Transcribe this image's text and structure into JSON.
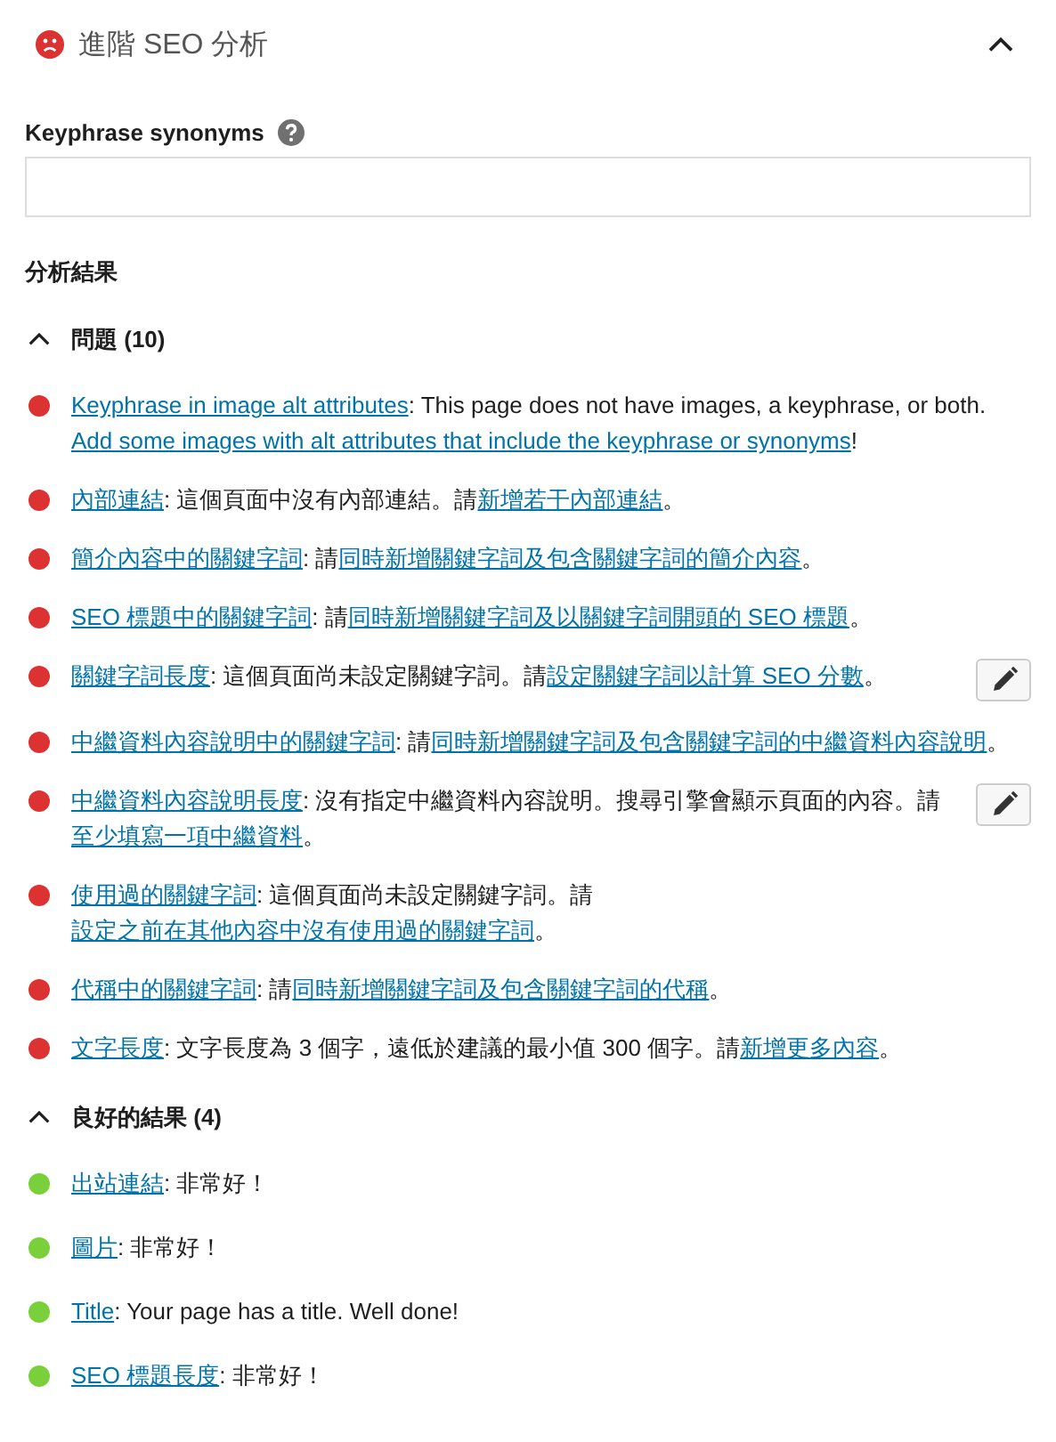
{
  "panel": {
    "title": "進階 SEO 分析",
    "expanded": true
  },
  "synonyms": {
    "label": "Keyphrase synonyms"
  },
  "results_heading": "分析結果",
  "groups": [
    {
      "title": "問題 (10)",
      "expanded": true,
      "items": [
        {
          "color": "#dc3232",
          "editable": false,
          "parts": [
            {
              "kind": "link",
              "text": "Keyphrase in image alt attributes"
            },
            {
              "kind": "text",
              "text": ": This page does not have images, a keyphrase, or both. "
            },
            {
              "kind": "link",
              "text": "Add some images with alt attributes that include the keyphrase or synonyms"
            },
            {
              "kind": "text",
              "text": "!"
            }
          ]
        },
        {
          "color": "#dc3232",
          "editable": false,
          "parts": [
            {
              "kind": "link",
              "text": "內部連結"
            },
            {
              "kind": "text",
              "text": ": 這個頁面中沒有內部連結。請"
            },
            {
              "kind": "link",
              "text": "新增若干內部連結"
            },
            {
              "kind": "text",
              "text": "。"
            }
          ]
        },
        {
          "color": "#dc3232",
          "editable": false,
          "parts": [
            {
              "kind": "link",
              "text": "簡介內容中的關鍵字詞"
            },
            {
              "kind": "text",
              "text": ": 請"
            },
            {
              "kind": "link",
              "text": "同時新增關鍵字詞及包含關鍵字詞的簡介內容"
            },
            {
              "kind": "text",
              "text": "。"
            }
          ]
        },
        {
          "color": "#dc3232",
          "editable": false,
          "parts": [
            {
              "kind": "link",
              "text": "SEO 標題中的關鍵字詞"
            },
            {
              "kind": "text",
              "text": ": 請"
            },
            {
              "kind": "link",
              "text": "同時新增關鍵字詞及以關鍵字詞開頭的 SEO 標題"
            },
            {
              "kind": "text",
              "text": "。"
            }
          ]
        },
        {
          "color": "#dc3232",
          "editable": true,
          "parts": [
            {
              "kind": "link",
              "text": "關鍵字詞長度"
            },
            {
              "kind": "text",
              "text": ": 這個頁面尚未設定關鍵字詞。請"
            },
            {
              "kind": "link",
              "text": "設定關鍵字詞以計算 SEO 分數"
            },
            {
              "kind": "text",
              "text": "。"
            }
          ]
        },
        {
          "color": "#dc3232",
          "editable": false,
          "parts": [
            {
              "kind": "link",
              "text": "中繼資料內容說明中的關鍵字詞"
            },
            {
              "kind": "text",
              "text": ": 請"
            },
            {
              "kind": "link",
              "text": "同時新增關鍵字詞及包含關鍵字詞的中繼資料內容說明"
            },
            {
              "kind": "text",
              "text": "。"
            }
          ]
        },
        {
          "color": "#dc3232",
          "editable": true,
          "parts": [
            {
              "kind": "link",
              "text": "中繼資料內容說明長度"
            },
            {
              "kind": "text",
              "text": ": 沒有指定中繼資料內容說明。搜尋引擎會顯示頁面的內容。請"
            },
            {
              "kind": "link",
              "text": "至少填寫一項中繼資料"
            },
            {
              "kind": "text",
              "text": "。"
            }
          ]
        },
        {
          "color": "#dc3232",
          "editable": false,
          "parts": [
            {
              "kind": "link",
              "text": "使用過的關鍵字詞"
            },
            {
              "kind": "text",
              "text": ": 這個頁面尚未設定關鍵字詞。請"
            },
            {
              "kind": "link",
              "text": "設定之前在其他內容中沒有使用過的關鍵字詞"
            },
            {
              "kind": "text",
              "text": "。"
            }
          ]
        },
        {
          "color": "#dc3232",
          "editable": false,
          "parts": [
            {
              "kind": "link",
              "text": "代稱中的關鍵字詞"
            },
            {
              "kind": "text",
              "text": ": 請"
            },
            {
              "kind": "link",
              "text": "同時新增關鍵字詞及包含關鍵字詞的代稱"
            },
            {
              "kind": "text",
              "text": "。"
            }
          ]
        },
        {
          "color": "#dc3232",
          "editable": false,
          "parts": [
            {
              "kind": "link",
              "text": "文字長度"
            },
            {
              "kind": "text",
              "text": ": 文字長度為 3 個字，遠低於建議的最小值 300 個字。請"
            },
            {
              "kind": "link",
              "text": "新增更多內容"
            },
            {
              "kind": "text",
              "text": "。"
            }
          ]
        }
      ]
    },
    {
      "title": "良好的結果 (4)",
      "expanded": true,
      "items": [
        {
          "color": "#7ad03a",
          "editable": false,
          "parts": [
            {
              "kind": "link",
              "text": "出站連結"
            },
            {
              "kind": "text",
              "text": ": 非常好！"
            }
          ]
        },
        {
          "color": "#7ad03a",
          "editable": false,
          "parts": [
            {
              "kind": "link",
              "text": "圖片"
            },
            {
              "kind": "text",
              "text": ": 非常好！"
            }
          ]
        },
        {
          "color": "#7ad03a",
          "editable": false,
          "parts": [
            {
              "kind": "link",
              "text": "Title"
            },
            {
              "kind": "text",
              "text": ": Your page has a title. Well done!"
            }
          ]
        },
        {
          "color": "#7ad03a",
          "editable": false,
          "parts": [
            {
              "kind": "link",
              "text": "SEO 標題長度"
            },
            {
              "kind": "text",
              "text": ": 非常好！"
            }
          ]
        }
      ]
    }
  ]
}
